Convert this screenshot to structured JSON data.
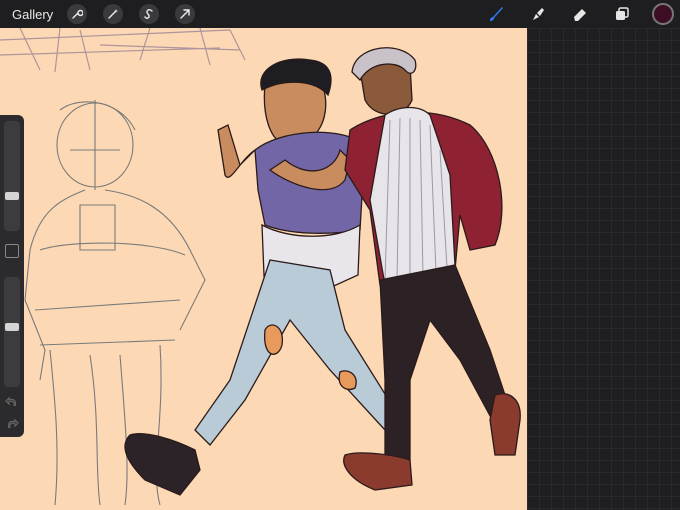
{
  "toolbar": {
    "gallery_label": "Gallery",
    "left_tools": [
      "wrench-icon",
      "magic-wand-icon",
      "selection-icon",
      "transform-icon"
    ],
    "right_tools": [
      "brush-icon",
      "smudge-icon",
      "eraser-icon",
      "layers-icon"
    ],
    "active_tool": "brush-icon",
    "color": "#3d0d24",
    "accent": "#2f7bf5"
  },
  "sidebar": {
    "brush_size_level": 0.3,
    "opacity_level": 0.55
  }
}
